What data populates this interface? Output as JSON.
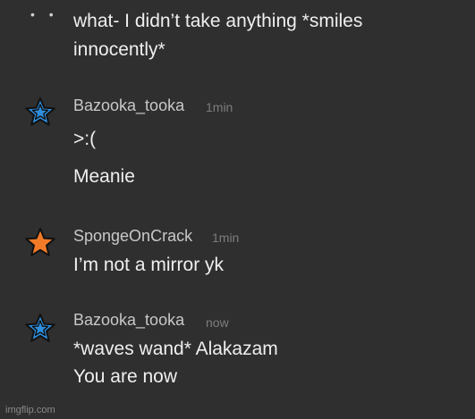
{
  "first_message": {
    "line1": "what- I didn’t take anything *smiles",
    "line2": "innocently*"
  },
  "messages": [
    {
      "author": "Bazooka_tooka",
      "time": "1min",
      "avatar_icon": "blue-star-icon",
      "lines": [
        ">:(",
        "Meanie"
      ]
    },
    {
      "author": "SpongeOnCrack",
      "time": "1min",
      "avatar_icon": "orange-star-icon",
      "lines": [
        "I’m not a mirror yk"
      ]
    },
    {
      "author": "Bazooka_tooka",
      "time": "now",
      "avatar_icon": "blue-star-icon",
      "lines": [
        "*waves wand* Alakazam",
        "You are now"
      ]
    }
  ],
  "colors": {
    "background": "#2f2f2f",
    "blue_star": "#2e8fe0",
    "orange_star": "#f07a28"
  },
  "watermark": "imgflip.com"
}
